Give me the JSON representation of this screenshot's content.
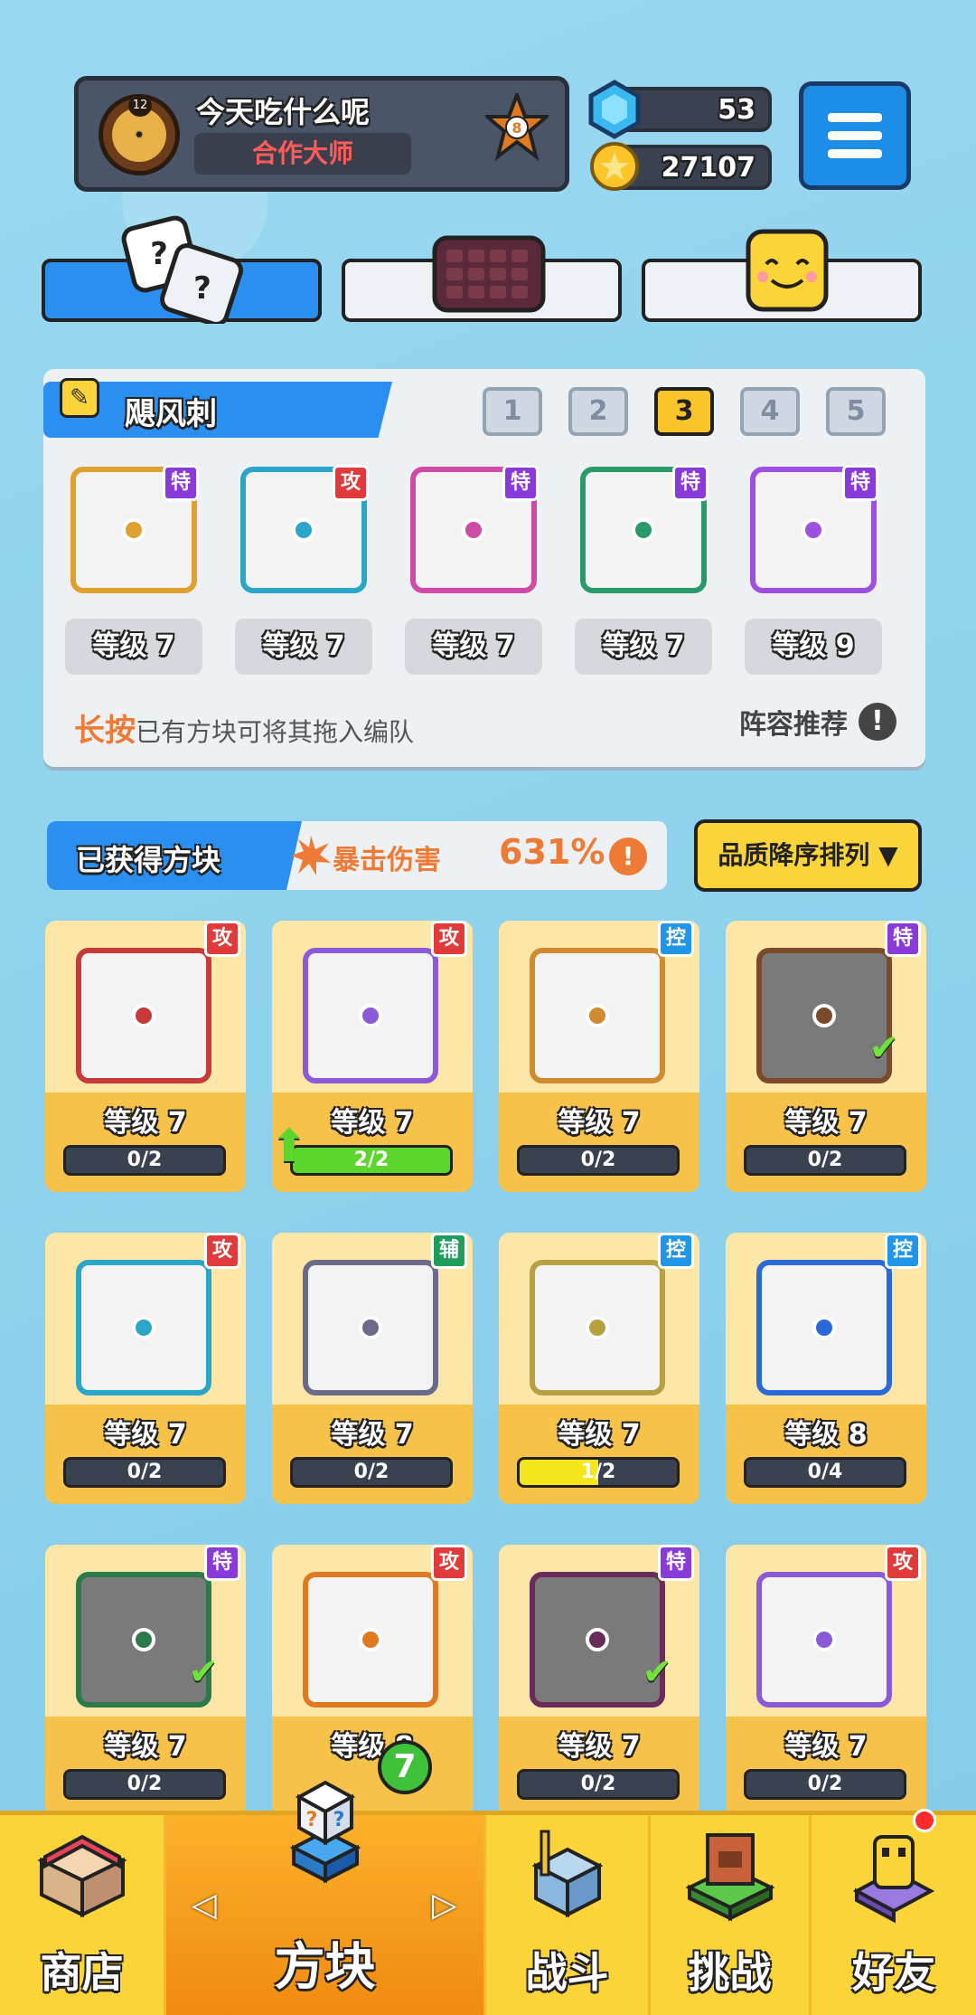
{
  "profile": {
    "name": "今天吃什么呢",
    "title": "合作大师",
    "avatar_level": "12",
    "rank": "8"
  },
  "currency": {
    "gems": "53",
    "gold": "27107"
  },
  "deck_tabs": [
    {
      "name": "dice-tab"
    },
    {
      "name": "board-tab"
    },
    {
      "name": "emoji-tab"
    }
  ],
  "deck": {
    "name": "飓风刺",
    "slots": [
      "1",
      "2",
      "3",
      "4",
      "5"
    ],
    "active_slot": 2,
    "cards": [
      {
        "badge": "特",
        "badge_type": "spec",
        "level": "等级 7",
        "color": "#e0a030"
      },
      {
        "badge": "攻",
        "badge_type": "atk",
        "level": "等级 7",
        "color": "#2aa7c8"
      },
      {
        "badge": "特",
        "badge_type": "spec",
        "level": "等级 7",
        "color": "#d04aa8"
      },
      {
        "badge": "特",
        "badge_type": "spec",
        "level": "等级 7",
        "color": "#2a9a6a"
      },
      {
        "badge": "特",
        "badge_type": "spec",
        "level": "等级 9",
        "color": "#a050e0"
      }
    ],
    "hint_strong": "长按",
    "hint_rest": "已有方块可将其拖入编队",
    "recommend": "阵容推荐",
    "recommend_icon": "!"
  },
  "owned": {
    "label": "已获得方块",
    "crit_label": "暴击伤害",
    "crit_value": "631%",
    "crit_icon": "!",
    "sort_label": "品质降序排列 ▼"
  },
  "grid": [
    {
      "badge": "攻",
      "badge_type": "atk",
      "level": "等级 7",
      "progress": "0/2",
      "fill": 0,
      "color": "#c83a3a",
      "checked": false,
      "upgrade": false
    },
    {
      "badge": "攻",
      "badge_type": "atk",
      "level": "等级 7",
      "progress": "2/2",
      "fill": 1,
      "color": "#8a5ad8",
      "checked": false,
      "upgrade": true
    },
    {
      "badge": "控",
      "badge_type": "ctl",
      "level": "等级 7",
      "progress": "0/2",
      "fill": 0,
      "color": "#d08a30",
      "checked": false,
      "upgrade": false
    },
    {
      "badge": "特",
      "badge_type": "spec",
      "level": "等级 7",
      "progress": "0/2",
      "fill": 0,
      "color": "#7a4a2a",
      "checked": true,
      "upgrade": false
    },
    {
      "badge": "攻",
      "badge_type": "atk",
      "level": "等级 7",
      "progress": "0/2",
      "fill": 0,
      "color": "#2aa7c8",
      "checked": false,
      "upgrade": false
    },
    {
      "badge": "辅",
      "badge_type": "sup",
      "level": "等级 7",
      "progress": "0/2",
      "fill": 0,
      "color": "#6a6a8a",
      "checked": false,
      "upgrade": false
    },
    {
      "badge": "控",
      "badge_type": "ctl",
      "level": "等级 7",
      "progress": "1/2",
      "fill": 0.5,
      "color": "#b8a040",
      "checked": false,
      "upgrade": false
    },
    {
      "badge": "控",
      "badge_type": "ctl",
      "level": "等级 8",
      "progress": "0/4",
      "fill": 0,
      "color": "#2a6ad8",
      "checked": false,
      "upgrade": false
    },
    {
      "badge": "特",
      "badge_type": "spec",
      "level": "等级 7",
      "progress": "0/2",
      "fill": 0,
      "color": "#2a7a4a",
      "checked": true,
      "upgrade": false
    },
    {
      "badge": "攻",
      "badge_type": "atk",
      "level": "等级 8",
      "progress": "",
      "fill": 0,
      "color": "#e07a20",
      "checked": false,
      "upgrade": false
    },
    {
      "badge": "特",
      "badge_type": "spec",
      "level": "等级 7",
      "progress": "0/2",
      "fill": 0,
      "color": "#6a2a5a",
      "checked": true,
      "upgrade": false
    },
    {
      "badge": "攻",
      "badge_type": "atk",
      "level": "等级 7",
      "progress": "0/2",
      "fill": 0,
      "color": "#8a5ad8",
      "checked": false,
      "upgrade": false
    }
  ],
  "nav": {
    "shop": "商店",
    "blocks": "方块",
    "battle": "战斗",
    "challenge": "挑战",
    "friends": "好友",
    "blocks_badge": "7",
    "prev": "◁",
    "next": "▷"
  }
}
